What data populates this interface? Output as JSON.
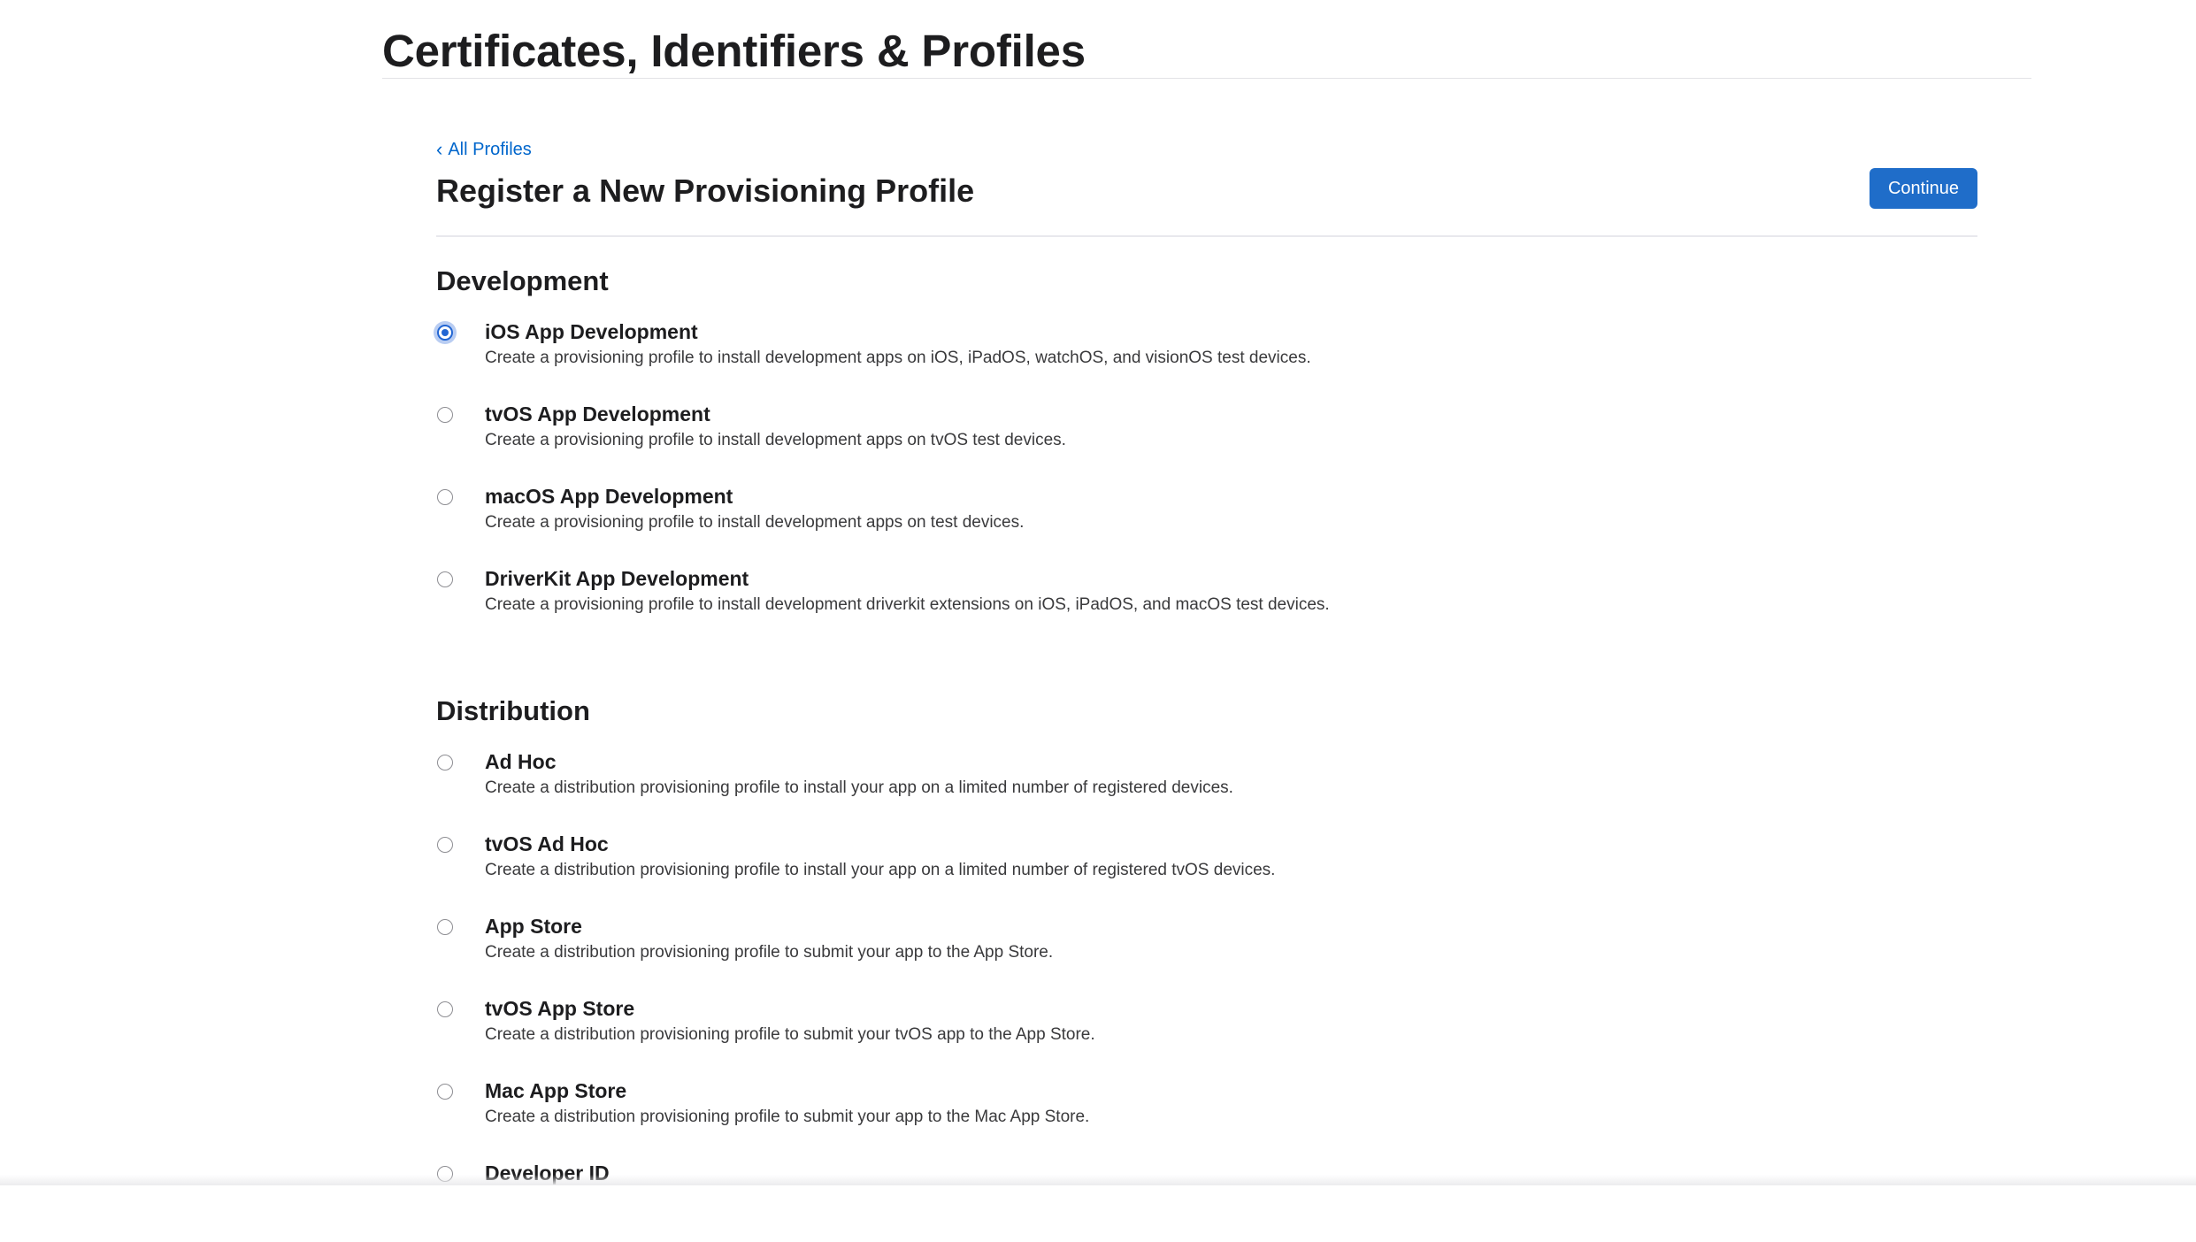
{
  "header": {
    "title": "Certificates, Identifiers & Profiles"
  },
  "back_link": {
    "label": "All Profiles"
  },
  "page": {
    "title": "Register a New Provisioning Profile",
    "continue_label": "Continue"
  },
  "sections": {
    "development": {
      "heading": "Development",
      "options": [
        {
          "label": "iOS App Development",
          "description": "Create a provisioning profile to install development apps on iOS, iPadOS, watchOS, and visionOS test devices.",
          "selected": true
        },
        {
          "label": "tvOS App Development",
          "description": "Create a provisioning profile to install development apps on tvOS test devices.",
          "selected": false
        },
        {
          "label": "macOS App Development",
          "description": "Create a provisioning profile to install development apps on test devices.",
          "selected": false
        },
        {
          "label": "DriverKit App Development",
          "description": "Create a provisioning profile to install development driverkit extensions on iOS, iPadOS, and macOS test devices.",
          "selected": false
        }
      ]
    },
    "distribution": {
      "heading": "Distribution",
      "options": [
        {
          "label": "Ad Hoc",
          "description": "Create a distribution provisioning profile to install your app on a limited number of registered devices.",
          "selected": false
        },
        {
          "label": "tvOS Ad Hoc",
          "description": "Create a distribution provisioning profile to install your app on a limited number of registered tvOS devices.",
          "selected": false
        },
        {
          "label": "App Store",
          "description": "Create a distribution provisioning profile to submit your app to the App Store.",
          "selected": false
        },
        {
          "label": "tvOS App Store",
          "description": "Create a distribution provisioning profile to submit your tvOS app to the App Store.",
          "selected": false
        },
        {
          "label": "Mac App Store",
          "description": "Create a distribution provisioning profile to submit your app to the Mac App Store.",
          "selected": false
        },
        {
          "label": "Developer ID",
          "description": "",
          "selected": false
        }
      ]
    }
  },
  "colors": {
    "accent": "#1f6dc9",
    "link": "#0066cc",
    "text": "#1d1d1f"
  },
  "icons": {
    "back": "chevron-left-icon"
  }
}
